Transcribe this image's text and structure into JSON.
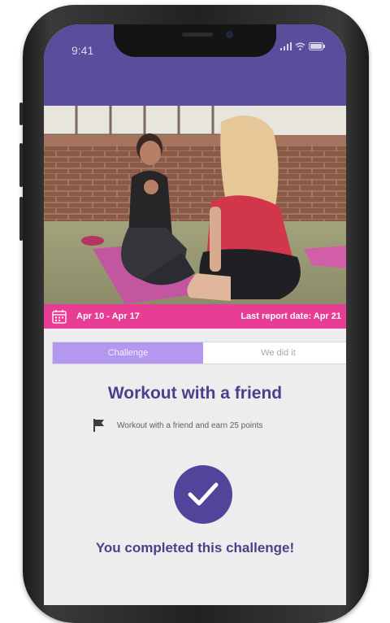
{
  "status_bar": {
    "time": "9:41",
    "signal_icon": "signal-icon",
    "wifi_icon": "wifi-icon",
    "battery_icon": "battery-icon"
  },
  "banner": {
    "date_range": "Apr 10 - Apr 17",
    "last_report": "Last report date: Apr 21",
    "color": "#e83d95"
  },
  "tabs": [
    {
      "label": "Challenge",
      "active": true
    },
    {
      "label": "We did it",
      "active": false
    }
  ],
  "challenge": {
    "title": "Workout with a friend",
    "description": "Workout with a friend and earn 25 points",
    "completed_text": "You completed this challenge!"
  },
  "colors": {
    "header": "#5b4c9c",
    "accent": "#51449a",
    "tab_active": "#b497ee"
  }
}
